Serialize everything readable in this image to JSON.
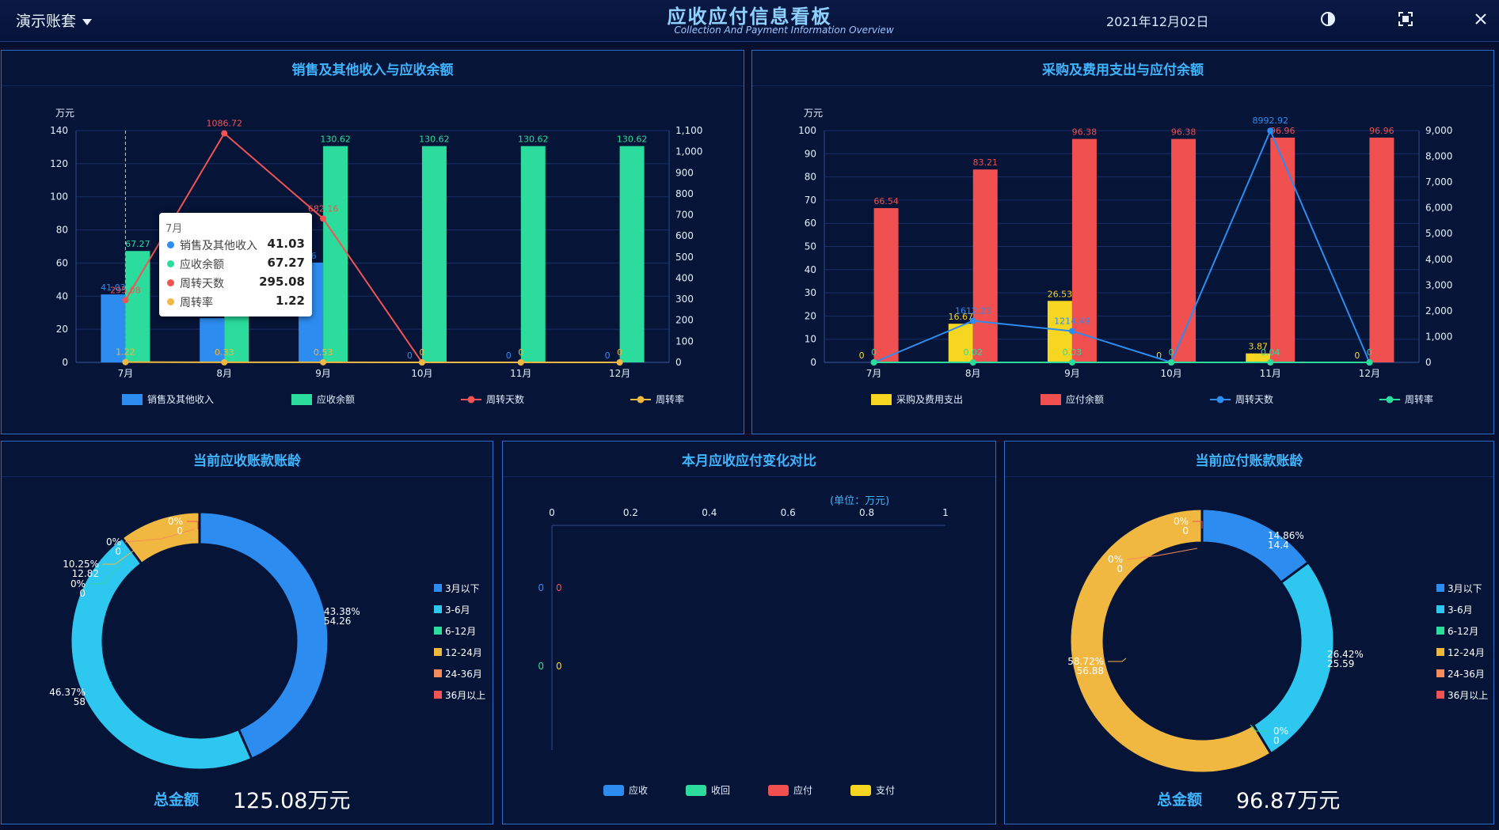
{
  "header": {
    "account": "演示账套",
    "title": "应收应付信息看板",
    "subtitle": "Collection And Payment Information Overview",
    "date": "2021年12月02日"
  },
  "panels": {
    "sales": "销售及其他收入与应收余额",
    "purchase": "采购及费用支出与应付余额",
    "ar_aging": "当前应收账款账龄",
    "compare": "本月应收应付变化对比",
    "ap_aging": "当前应付账款账龄"
  },
  "totals": {
    "label": "总金额",
    "ar_value": "125.08万元",
    "ap_value": "96.87万元"
  },
  "compare_unit": "(单位：万元)",
  "tooltip": {
    "header": "7月",
    "rows": [
      {
        "label": "销售及其他收入",
        "value": "41.03",
        "color": "#2d8cf0"
      },
      {
        "label": "应收余额",
        "value": "67.27",
        "color": "#2bdc9c"
      },
      {
        "label": "周转天数",
        "value": "295.08",
        "color": "#f05454"
      },
      {
        "label": "周转率",
        "value": "1.22",
        "color": "#f0b840"
      }
    ]
  },
  "chart_data": [
    {
      "type": "bar",
      "categories": [
        "7月",
        "8月",
        "9月",
        "10月",
        "11月",
        "12月"
      ],
      "ylabel": "万元",
      "ylim": [
        0,
        140
      ],
      "y2lim": [
        0,
        1100
      ],
      "series": [
        {
          "name": "销售及其他收入",
          "axis": "left",
          "type": "bar",
          "color": "#2d8cf0",
          "values": [
            41.03,
            26.71,
            60.26,
            0,
            0,
            0
          ],
          "labels": [
            "41.03",
            "26.71",
            "26",
            "0",
            "0",
            "0"
          ]
        },
        {
          "name": "应收余额",
          "axis": "left",
          "type": "bar",
          "color": "#2bdc9c",
          "values": [
            67.27,
            80.0,
            130.62,
            130.62,
            130.62,
            130.62
          ],
          "labels": [
            "67.27",
            "",
            "130.62",
            "130.62",
            "130.62",
            "130.62"
          ]
        },
        {
          "name": "周转天数",
          "axis": "right",
          "type": "line",
          "color": "#f05454",
          "values": [
            295.08,
            1086.72,
            682.16,
            0,
            0,
            0
          ],
          "labels": [
            "295.08",
            "1086.72",
            "682.16",
            "",
            "",
            ""
          ]
        },
        {
          "name": "周转率",
          "axis": "right",
          "type": "line",
          "color": "#f0b840",
          "values": [
            1.22,
            0.33,
            0.53,
            0,
            0,
            0
          ],
          "labels": [
            "1.22",
            "0.33",
            "0.53",
            "0",
            "0",
            "0"
          ]
        }
      ],
      "legend": "bottom"
    },
    {
      "type": "bar",
      "categories": [
        "7月",
        "8月",
        "9月",
        "10月",
        "11月",
        "12月"
      ],
      "ylabel": "万元",
      "ylim": [
        0,
        100
      ],
      "y2lim": [
        0,
        9000
      ],
      "series": [
        {
          "name": "采购及费用支出",
          "axis": "left",
          "type": "bar",
          "color": "#f7d622",
          "values": [
            0,
            16.67,
            26.53,
            0,
            3.87,
            0
          ],
          "labels": [
            "0",
            "16.67",
            "26.53",
            "0",
            "3.87",
            "0"
          ]
        },
        {
          "name": "应付余额",
          "axis": "left",
          "type": "bar",
          "color": "#f05050",
          "values": [
            66.54,
            83.21,
            96.38,
            96.38,
            96.96,
            96.96
          ],
          "labels": [
            "66.54",
            "83.21",
            "96.38",
            "96.38",
            "96.96",
            "96.96"
          ]
        },
        {
          "name": "周转天数",
          "axis": "right",
          "type": "line",
          "color": "#2d8cf0",
          "values": [
            0,
            1612.23,
            1214.49,
            0,
            8992.92,
            0
          ],
          "labels": [
            "",
            "1612.23",
            "1214.49",
            "",
            "8992.92",
            ""
          ]
        },
        {
          "name": "周转率",
          "axis": "right",
          "type": "line",
          "color": "#2bdc9c",
          "values": [
            0,
            0.02,
            0.03,
            0,
            0.04,
            0
          ],
          "labels": [
            "0",
            "0.02",
            "0.03",
            "0",
            "0.04",
            "0"
          ]
        }
      ],
      "legend": "bottom"
    },
    {
      "type": "pie",
      "categories": [
        "3月以下",
        "3-6月",
        "6-12月",
        "12-24月",
        "24-36月",
        "36月以上"
      ],
      "values": [
        54.26,
        58,
        0,
        12.82,
        0,
        0
      ],
      "percent": [
        "43.38%",
        "46.37%",
        "0%",
        "10.25%",
        "0%",
        "0%"
      ],
      "colors": [
        "#2d8cf0",
        "#2ec7f0",
        "#2bdc9c",
        "#f0b840",
        "#f58c5c",
        "#f05454"
      ],
      "legend": "right"
    },
    {
      "type": "bar",
      "orientation": "horizontal",
      "xlim": [
        0,
        1
      ],
      "xticks": [
        "0",
        "0.2",
        "0.4",
        "0.6",
        "0.8",
        "1"
      ],
      "series": [
        {
          "name": "应收",
          "color": "#2d8cf0",
          "values": [
            0
          ]
        },
        {
          "name": "收回",
          "color": "#2bdc9c",
          "values": [
            0
          ]
        },
        {
          "name": "应付",
          "color": "#f05050",
          "values": [
            0
          ]
        },
        {
          "name": "支付",
          "color": "#f7d622",
          "values": [
            0
          ]
        }
      ],
      "legend": "bottom"
    },
    {
      "type": "pie",
      "categories": [
        "3月以下",
        "3-6月",
        "6-12月",
        "12-24月",
        "24-36月",
        "36月以上"
      ],
      "values": [
        14.4,
        25.59,
        0,
        56.88,
        0,
        0
      ],
      "percent": [
        "14.86%",
        "26.42%",
        "0%",
        "58.72%",
        "0%",
        "0%"
      ],
      "colors": [
        "#2d8cf0",
        "#2ec7f0",
        "#2bdc9c",
        "#f0b840",
        "#f58c5c",
        "#f05454"
      ],
      "legend": "right"
    }
  ]
}
